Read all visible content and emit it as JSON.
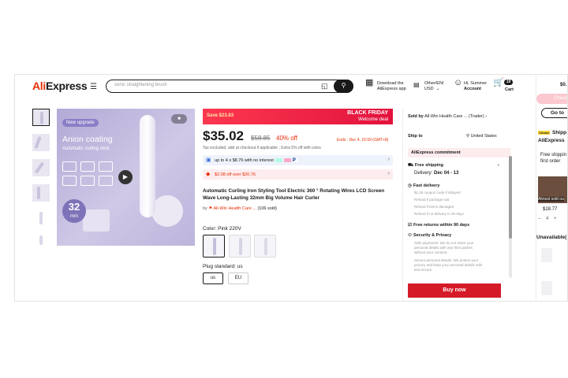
{
  "header": {
    "logo_a": "Ali",
    "logo_b": "Express",
    "search_placeholder": "sonic straightening brush",
    "download_line1": "Download the",
    "download_line2": "AliExpress app",
    "locale_line1": "Other/EN/",
    "locale_line2": "USD",
    "account_line1": "Hi, Summer",
    "account_line2": "Account",
    "cart_count": "19",
    "cart_label": "Cart"
  },
  "gallery": {
    "badge": "New upgrade",
    "headline": "Anion coating",
    "subline": "Automatic curling stick",
    "size_num": "32",
    "size_unit": "mm"
  },
  "promo": {
    "save": "Save $23.83",
    "event": "BLACK FRIDAY",
    "event_sub": "Welcome deal"
  },
  "price": {
    "current": "$35.02",
    "original": "$58.85",
    "discount": "40% off",
    "ends": "Ends : Dec 4, 15:59 (GMT+8)",
    "tax": "Tax excluded, add at checkout if applicable ; Extra 5% off with coins"
  },
  "offers": {
    "installment": "up to 4 x $8.76 with no interest",
    "coupon": "$2.08 off over $20.76"
  },
  "product": {
    "title": "Automatic Curling Iron Styling Tool Electric 360 ° Rotating Wires LCD Screen Wave Long-Lasting 32mm Big Volume Hair Curler",
    "by_prefix": "by",
    "store": "All-Win Health Care ...",
    "sold": "(106 sold)",
    "color_label": "Color: Pink 220V",
    "plug_label": "Plug standard: us",
    "plug_options": [
      "us",
      "EU"
    ]
  },
  "side": {
    "sold_by_label": "Sold by",
    "sold_by_store": "All-Win Health Care ...",
    "sold_by_type": "(Trader)",
    "ship_to_label": "Ship to",
    "ship_to_value": "United States",
    "commitment": "AliExpress commitment",
    "free_shipping": "Free shipping",
    "delivery_label": "Delivery:",
    "delivery_date": "Dec 04 - 13",
    "fast_delivery": "Fast delivery",
    "fast_items": [
      "$1.00 coupon code if delayed",
      "Refund if package lost",
      "Refund if items damaged",
      "Refund if no delivery in 30 days"
    ],
    "free_returns": "Free returns within 90 days",
    "security": "Security & Privacy",
    "security_items": [
      "Safe payments: We do not share your",
      "personal details with any third parties",
      "without your consent.",
      "Secure personal details: We protect your",
      "privacy and keep your personal details safe",
      "and secure."
    ],
    "buy_now": "Buy now"
  },
  "far_right": {
    "price": "$0.",
    "checkout": "Check",
    "goto": "Go to",
    "choice": "Choice",
    "shipping": "Shipp",
    "brand": "AliExpress",
    "free_ship1": "Free shippin",
    "free_ship2": "first order",
    "sold_out": "Almost sold ou",
    "item_price": "$28.77",
    "qty": "4",
    "unavailable": "Unavailable("
  },
  "colors": {
    "brand_red": "#e62e04",
    "buy_red": "#d51a27",
    "bf_red": "#fd384f",
    "lavender": "#b3a9d6"
  }
}
